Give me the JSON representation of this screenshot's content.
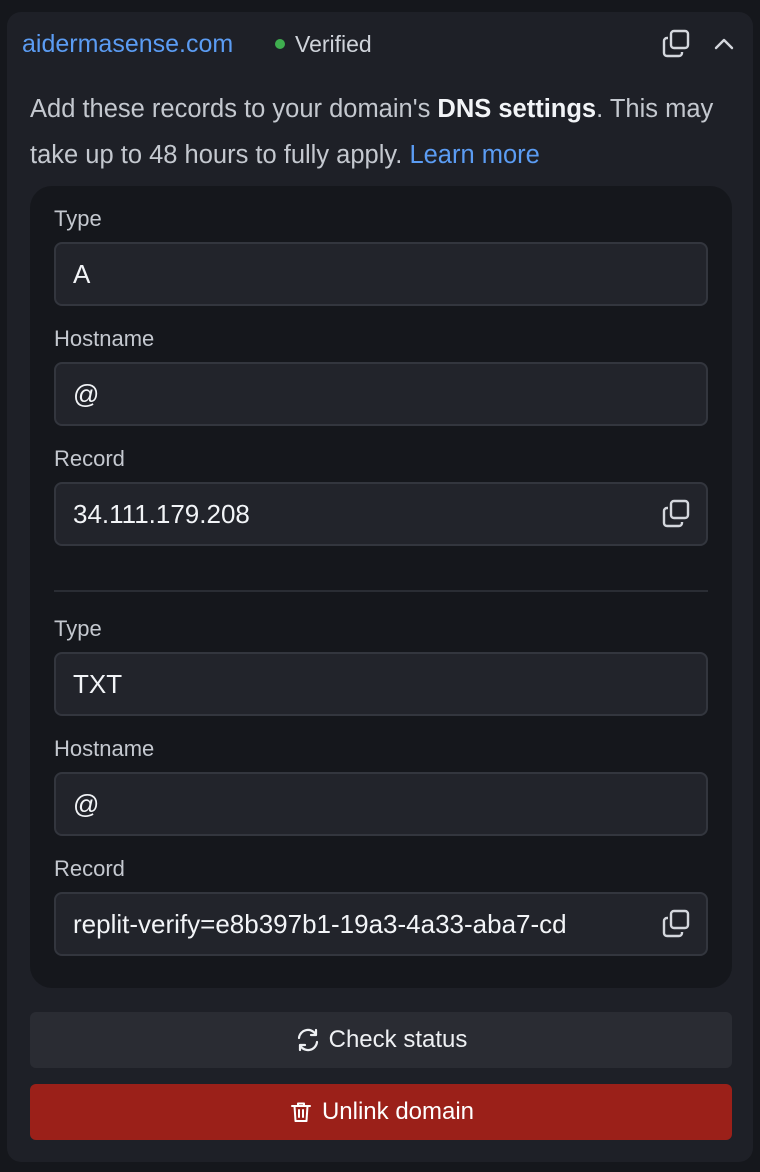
{
  "header": {
    "domain": "aidermasense.com",
    "status": "Verified",
    "status_color": "#3fae4f",
    "copy_icon": "copy-icon",
    "collapse_icon": "chevron-up-icon"
  },
  "description": {
    "prefix": "Add these records to your domain's ",
    "bold": "DNS settings",
    "suffix": ". This may take up to 48 hours to fully apply. ",
    "link": "Learn more"
  },
  "records": [
    {
      "type_label": "Type",
      "type": "A",
      "hostname_label": "Hostname",
      "hostname": "@",
      "record_label": "Record",
      "record": "34.111.179.208"
    },
    {
      "type_label": "Type",
      "type": "TXT",
      "hostname_label": "Hostname",
      "hostname": "@",
      "record_label": "Record",
      "record": "replit-verify=e8b397b1-19a3-4a33-aba7-cd"
    }
  ],
  "actions": {
    "check_status": "Check status",
    "check_icon": "refresh-icon",
    "unlink": "Unlink domain",
    "unlink_icon": "trash-icon",
    "unlink_color": "#9b2019"
  },
  "colors": {
    "accent": "#5b9cf3",
    "panel": "#1e2027",
    "background": "#15171c"
  }
}
